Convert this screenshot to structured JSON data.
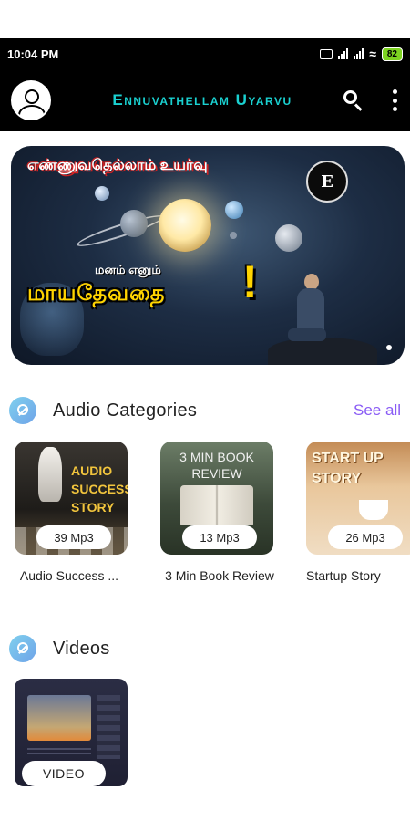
{
  "status_bar": {
    "time": "10:04 PM",
    "battery": "82"
  },
  "app_bar": {
    "title": "Ennuvathellam Uyarvu"
  },
  "banner": {
    "top_text": "எண்ணுவதெல்லாம் உயர்வு",
    "logo_text": "E",
    "mid_text": "மனம் எனும்",
    "main_text": "மாயதேவதை",
    "exclamation": "!"
  },
  "audio_categories": {
    "title": "Audio Categories",
    "see_all": "See all",
    "items": [
      {
        "art_text": "AUDIO SUCCESS STORY",
        "count": "39 Mp3",
        "label": "Audio Success ..."
      },
      {
        "art_text": "3 MIN BOOK REVIEW",
        "count": "13 Mp3",
        "label": "3 Min Book Review"
      },
      {
        "art_text": "START UP STORY",
        "count": "26 Mp3",
        "label": "Startup Story"
      }
    ]
  },
  "videos": {
    "title": "Videos",
    "items": [
      {
        "badge": "VIDEO"
      }
    ]
  }
}
